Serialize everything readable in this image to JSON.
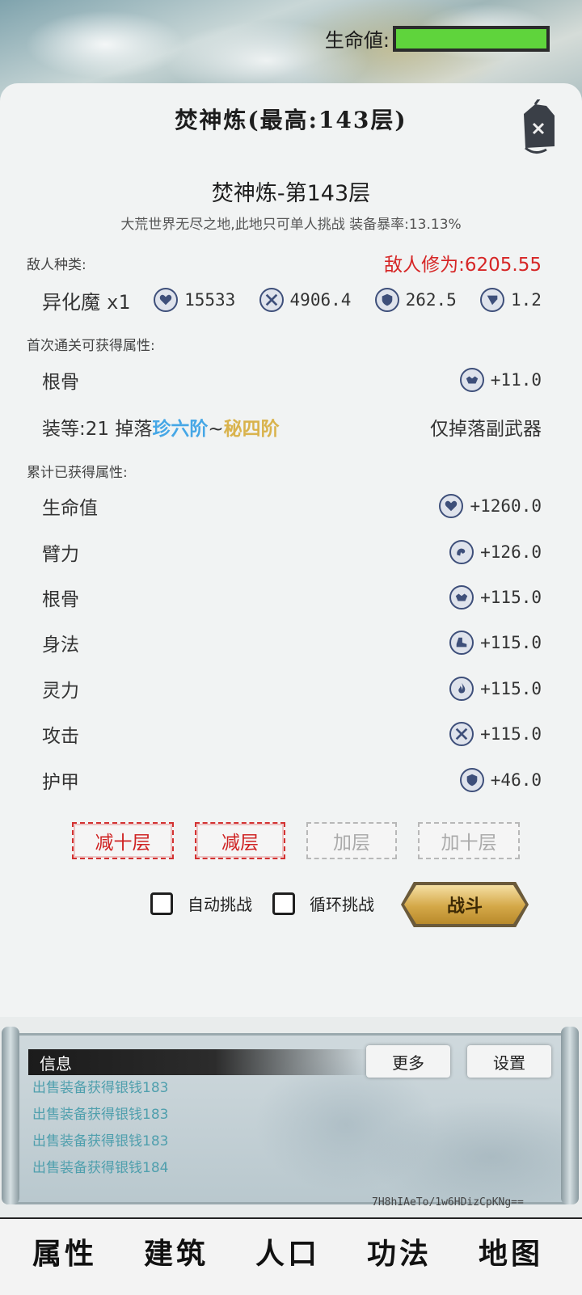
{
  "header": {
    "hp_label": "生命値:",
    "hp_fraction": 1.0
  },
  "panel": {
    "title": "焚神炼(最高:143层)",
    "floor_title": "焚神炼-第143层",
    "floor_desc": "大荒世界无尽之地,此地只可单人挑战 装备暴率:13.13%"
  },
  "enemy": {
    "section_label": "敌人种类:",
    "power_text": "敌人修为:6205.55",
    "name": "异化魔",
    "count": "x1",
    "hp": "15533",
    "attack": "4906.4",
    "armor": "262.5",
    "speed": "1.2"
  },
  "first_clear": {
    "section_label": "首次通关可获得属性:",
    "attr_name": "根骨",
    "attr_value": "+11.0",
    "gear_level": "装等:21 掉落",
    "drop_low": "珍六阶",
    "drop_sep": "~",
    "drop_high": "秘四阶",
    "drop_note": "仅掉落副武器"
  },
  "accumulated": {
    "section_label": "累计已获得属性:",
    "items": [
      {
        "name": "生命值",
        "value": "+1260.0",
        "icon": "heart-icon"
      },
      {
        "name": "臂力",
        "value": "+126.0",
        "icon": "strength-icon"
      },
      {
        "name": "根骨",
        "value": "+115.0",
        "icon": "constitution-icon"
      },
      {
        "name": "身法",
        "value": "+115.0",
        "icon": "boot-icon"
      },
      {
        "name": "灵力",
        "value": "+115.0",
        "icon": "spirit-icon"
      },
      {
        "name": "攻击",
        "value": "+115.0",
        "icon": "swords-icon"
      },
      {
        "name": "护甲",
        "value": "+46.0",
        "icon": "shield-icon"
      }
    ]
  },
  "controls": {
    "minus_ten": "减十层",
    "minus_one": "减层",
    "plus_one": "加层",
    "plus_ten": "加十层",
    "auto_label": "自动挑战",
    "loop_label": "循环挑战",
    "fight_label": "战斗"
  },
  "log": {
    "title": "信息",
    "more": "更多",
    "settings": "设置",
    "lines": [
      "出售装备获得银钱183",
      "出售装备获得银钱183",
      "出售装备获得银钱183",
      "出售装备获得银钱184"
    ],
    "hash": "7H8hIAeTo/1w6HDizCpKNg=="
  },
  "nav": {
    "items": [
      "属性",
      "建筑",
      "人口",
      "功法",
      "地图"
    ]
  },
  "colors": {
    "hp_green": "#5fd43c",
    "danger_red": "#d62626",
    "drop_blue": "#46a7e6",
    "drop_gold": "#d9b34d",
    "log_teal": "#4f9fad"
  }
}
